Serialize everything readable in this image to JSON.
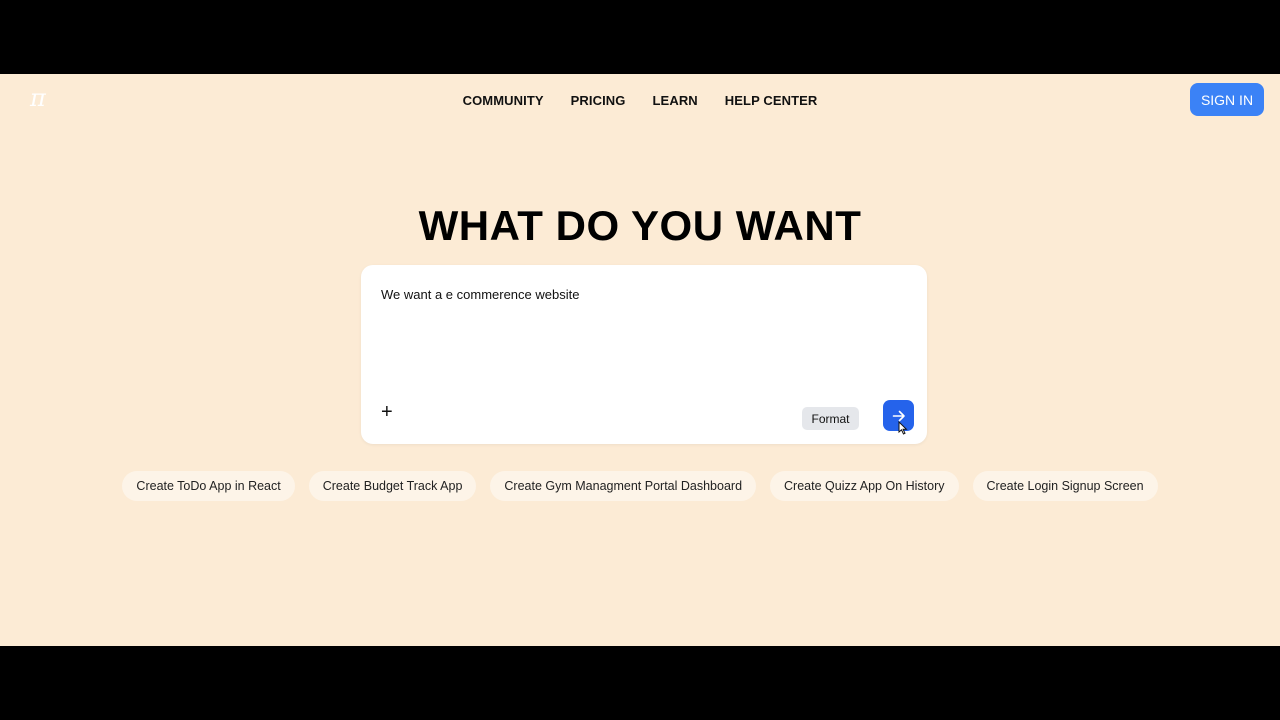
{
  "header": {
    "logo": "π",
    "nav": [
      "COMMUNITY",
      "PRICING",
      "LEARN",
      "HELP CENTER"
    ],
    "signin_label": "SIGN IN"
  },
  "main": {
    "heading": "WHAT DO YOU WANT",
    "prompt_text": "We want a e commerence website",
    "format_label": "Format",
    "suggestions": [
      "Create ToDo App in React",
      "Create Budget Track App",
      "Create Gym Managment Portal Dashboard",
      "Create Quizz App On History",
      "Create Login Signup Screen"
    ]
  },
  "colors": {
    "page_background": "#fcebd5",
    "accent": "#3b82f6",
    "send_button": "#2563eb"
  },
  "icons": {
    "add": "plus-icon",
    "send": "arrow-right-icon",
    "pointer": "mouse-cursor-icon"
  }
}
